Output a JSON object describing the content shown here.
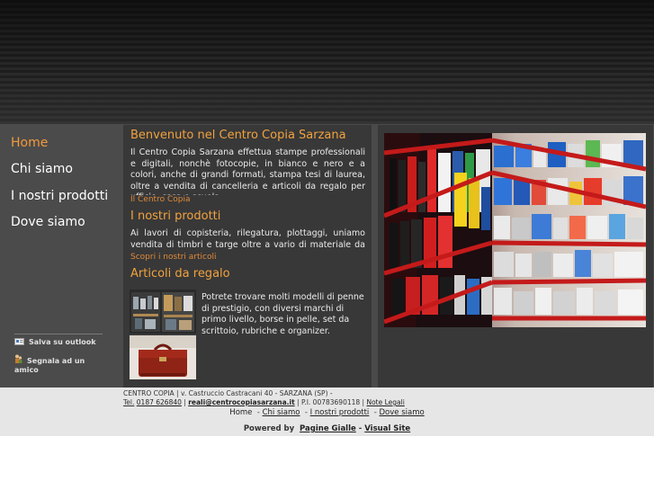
{
  "nav": [
    {
      "label": "Home",
      "active": true
    },
    {
      "label": "Chi siamo",
      "active": false
    },
    {
      "label": "I nostri prodotti",
      "active": false
    },
    {
      "label": "Dove siamo",
      "active": false
    }
  ],
  "tools": {
    "save": "Salva su outlook",
    "share": "Segnala ad un amico"
  },
  "sections": {
    "welcome": {
      "title": "Benvenuto nel Centro Copia Sarzana",
      "text": "Il Centro Copia Sarzana effettua stampe professionali e digitali, nonchè fotocopie, in bianco e nero e a colori, anche di grandi formati, stampa tesi di laurea, oltre a vendita di cancelleria e articoli da regalo per ufficio, casa e scuola.",
      "link": "Il Centro Copia"
    },
    "products": {
      "title": "I nostri prodotti",
      "text": "Ai lavori di copisteria, rilegatura, plottaggi, uniamo vendita di timbri e targe oltre a vario di materiale da ufficio.",
      "link": "Scopri i nostri articoli"
    },
    "gifts": {
      "title": "Articoli da regalo",
      "text": "Potrete trovare molti modelli di penne di prestigio, con diversi marchi di primo livello, borse in pelle, set da scrittoio, rubriche e organizer."
    }
  },
  "footer": {
    "company": "CENTRO COPIA | v. Castruccio Castracani 40 - SARZANA (SP) -",
    "tel_label": "Tel.",
    "phone": "0187 626840",
    "sep1": "|",
    "email": "reali@centrocopiasarzana.it",
    "piva": "| P.I. 00783690118 |",
    "legal": "Note Legali",
    "nav": [
      "Home",
      "Chi siamo",
      "I nostri prodotti",
      "Dove siamo"
    ],
    "powered_prefix": "Powered by",
    "pagine_gialle": "Pagine Gialle",
    "dash": "-",
    "visual_site": "Visual Site"
  },
  "colors": {
    "accent": "#f29a3c",
    "panel": "#383838",
    "sidebar": "#4b4b4b"
  }
}
